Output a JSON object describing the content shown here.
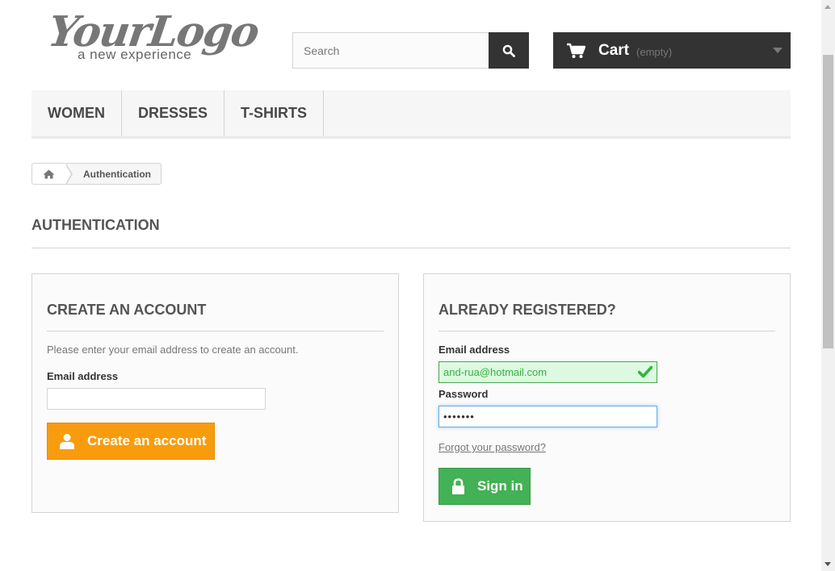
{
  "header": {
    "logo_main": "YourLogo",
    "logo_sub": "a new experience",
    "search_placeholder": "Search",
    "cart_label": "Cart",
    "cart_status": "(empty)"
  },
  "nav": {
    "items": [
      {
        "label": "WOMEN"
      },
      {
        "label": "DRESSES"
      },
      {
        "label": "T-SHIRTS"
      }
    ]
  },
  "breadcrumb": {
    "current": "Authentication"
  },
  "page": {
    "title": "AUTHENTICATION"
  },
  "create_account": {
    "title": "CREATE AN ACCOUNT",
    "description": "Please enter your email address to create an account.",
    "email_label": "Email address",
    "email_value": "",
    "button_label": "Create an account"
  },
  "login": {
    "title": "ALREADY REGISTERED?",
    "email_label": "Email address",
    "email_value": "and-rua@hotmail.com",
    "password_label": "Password",
    "password_value": "•••••••",
    "forgot_label": "Forgot your password?",
    "button_label": "Sign in"
  },
  "colors": {
    "accent_dark": "#333333",
    "create_button": "#f89c0e",
    "signin_button": "#43b155",
    "valid_field": "#ddf9e1"
  }
}
